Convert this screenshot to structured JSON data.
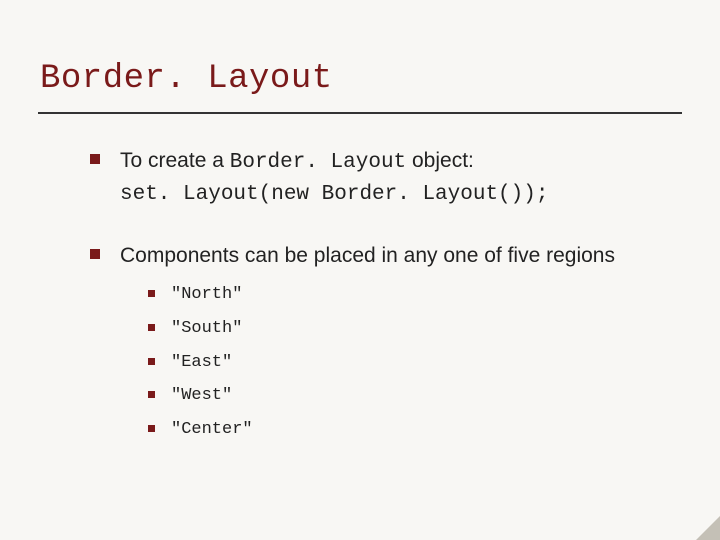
{
  "title": "Border. Layout",
  "items": [
    {
      "prefix": "To create a ",
      "code1": "Border. Layout",
      "mid": " object:",
      "code_line": "set. Layout(new Border. Layout());"
    },
    {
      "text": "Components can be placed in any one of five regions",
      "sub": [
        "\"North\"",
        "\"South\"",
        "\"East\"",
        "\"West\"",
        "\"Center\""
      ]
    }
  ]
}
